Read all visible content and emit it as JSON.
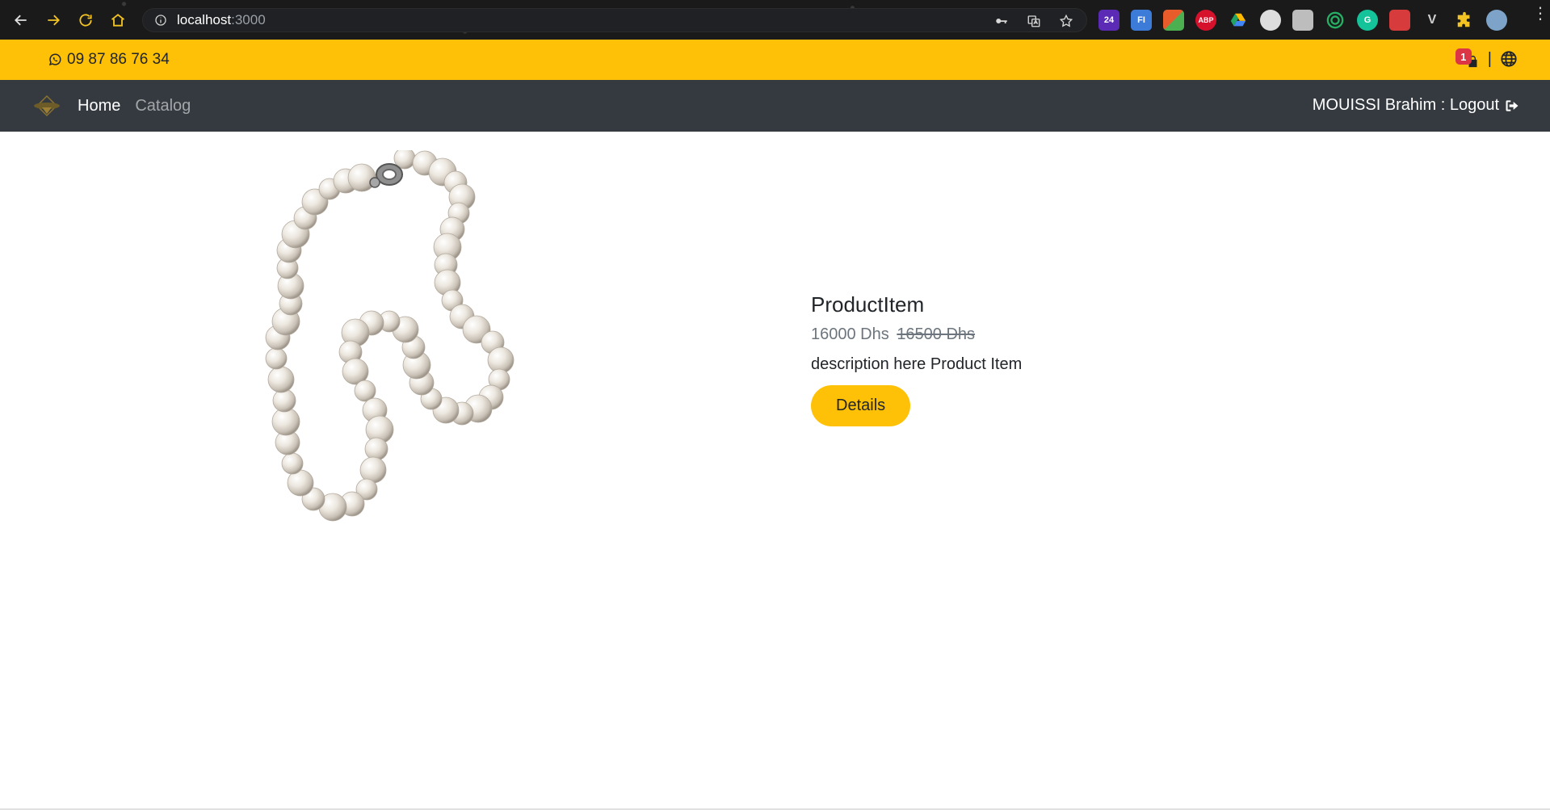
{
  "browser": {
    "url_host": "localhost",
    "url_port": ":3000",
    "extensions": [
      {
        "icon": "ext-24-icon",
        "label": "24",
        "color": "#5b2bb5"
      },
      {
        "icon": "ext-fi-icon",
        "label": "FI",
        "color": "#3d7bd8"
      },
      {
        "icon": "ext-color-icon",
        "label": "",
        "color": "#e85c2c"
      },
      {
        "icon": "ext-abp-icon",
        "label": "ABP",
        "color": "#d6112b"
      },
      {
        "icon": "google-drive-icon",
        "label": "",
        "color": "#1fa463"
      },
      {
        "icon": "ext-circle-icon",
        "label": "",
        "color": "#dddddd"
      },
      {
        "icon": "ext-folder-icon",
        "label": "",
        "color": "#bdbdbd"
      },
      {
        "icon": "ext-target-icon",
        "label": "",
        "color": "#25b065"
      },
      {
        "icon": "grammarly-icon",
        "label": "G",
        "color": "#15c39a"
      },
      {
        "icon": "ext-red-icon",
        "label": "",
        "color": "#d83b3b"
      },
      {
        "icon": "ext-v-icon",
        "label": "V",
        "color": "#cfcfcf"
      },
      {
        "icon": "puzzle-icon",
        "label": "",
        "color": "#f3c324"
      },
      {
        "icon": "profile-avatar-icon",
        "label": "",
        "color": "#7da3c8"
      }
    ]
  },
  "topbar": {
    "phone": "09 87 86 76 34",
    "cart_count": "1",
    "separator": "|"
  },
  "navbar": {
    "home": "Home",
    "catalog": "Catalog",
    "user_logout": "MOUISSI Brahim : Logout"
  },
  "product": {
    "title": "ProductItem",
    "price": "16000 Dhs",
    "old_price": "16500 Dhs",
    "description": "description here Product Item",
    "button": "Details"
  }
}
